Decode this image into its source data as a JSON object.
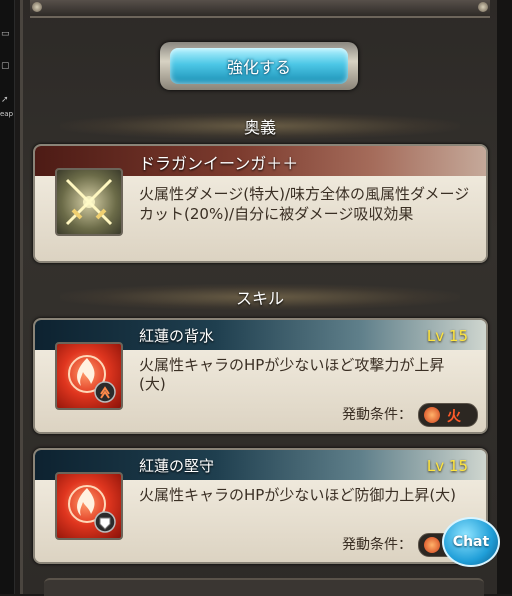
{
  "header": {
    "enhance_button_label": "強化する"
  },
  "ougi": {
    "section_title": "奥義",
    "name": "ドラガンイーンガ＋＋",
    "description": "火属性ダメージ(特大)/味方全体の風属性ダメージカット(20%)/自分に被ダメージ吸収効果",
    "icon": "crossed-swords-icon"
  },
  "skills": {
    "section_title": "スキル",
    "items": [
      {
        "name": "紅蓮の背水",
        "level": "Lv 15",
        "description": "火属性キャラのHPが少ないほど攻撃力が上昇(大)",
        "condition_label": "発動条件：",
        "condition_value": "火",
        "icon": "fire-emblem-icon"
      },
      {
        "name": "紅蓮の堅守",
        "level": "Lv 15",
        "description": "火属性キャラのHPが少ないほど防御力上昇(大)",
        "condition_label": "発動条件：",
        "condition_value": "火",
        "icon": "fire-emblem-icon"
      }
    ]
  },
  "chat_button_label": "Chat",
  "leftbar": {
    "fragment_text": "eap"
  },
  "colors": {
    "accent_blue": "#4cc7e6",
    "level_yellow": "#ffe640",
    "fire_red": "#e0361f"
  }
}
